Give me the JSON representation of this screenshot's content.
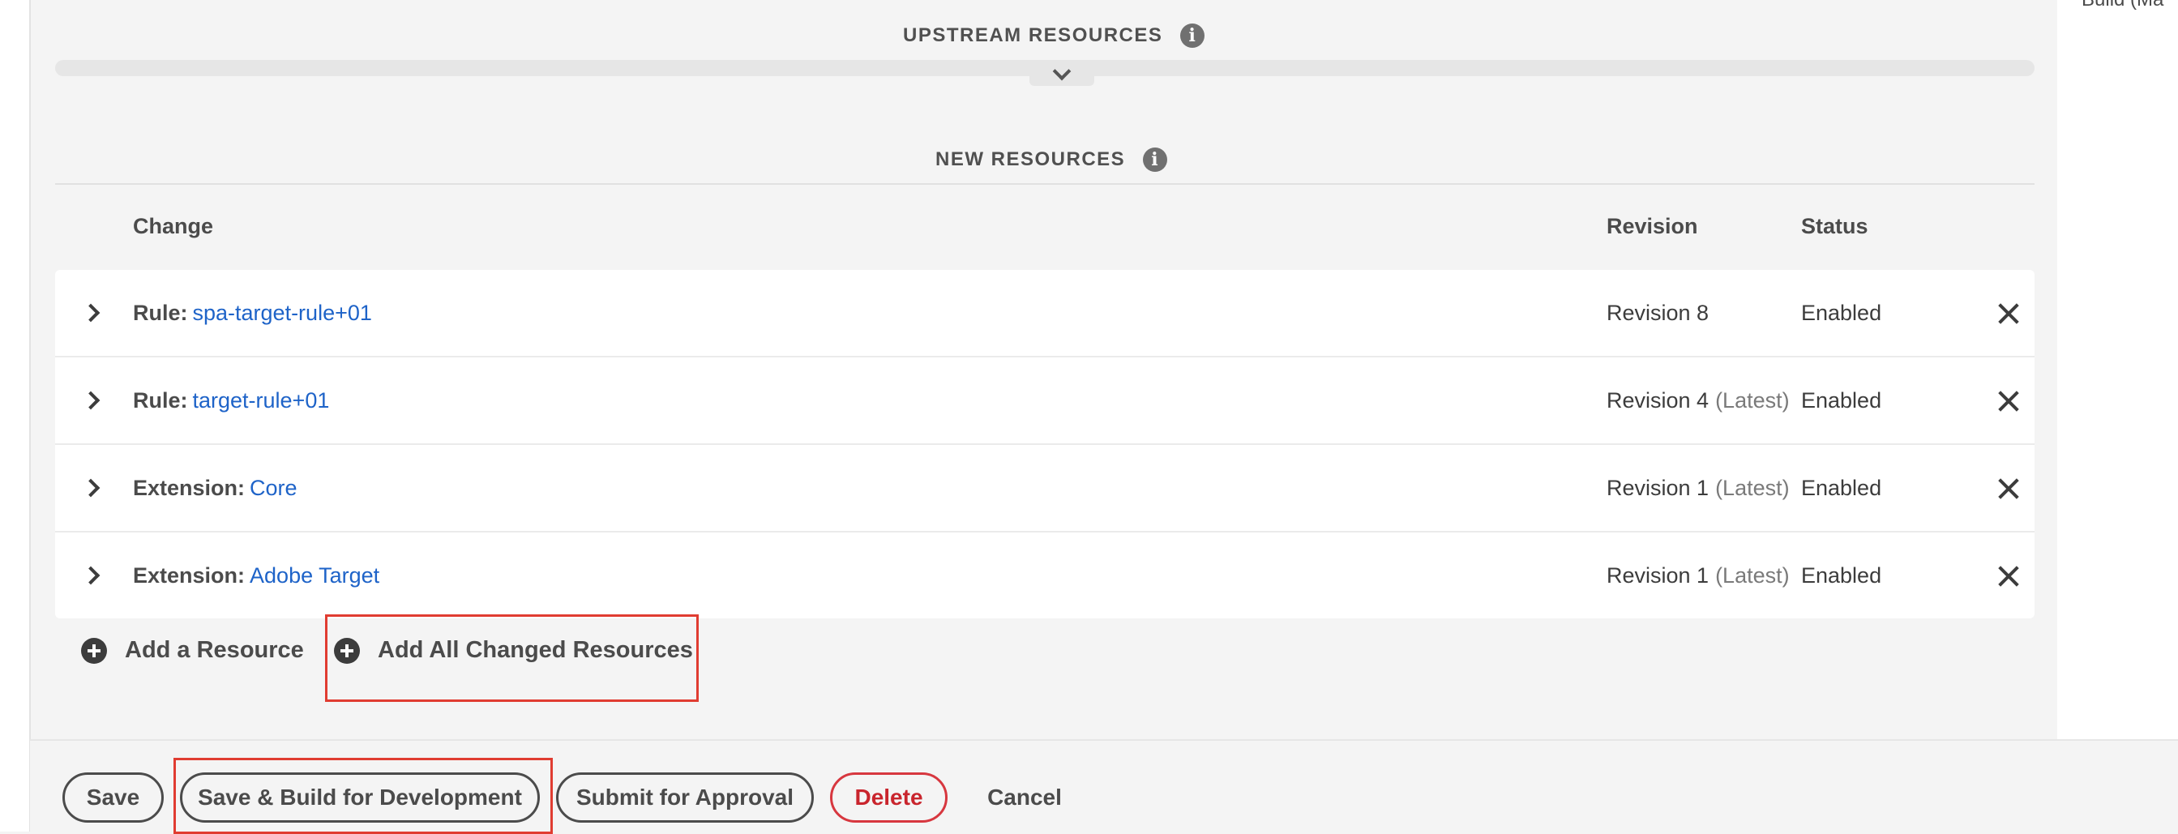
{
  "right_panel": {
    "partial_text": "Build (Ma"
  },
  "upstream": {
    "title": "UPSTREAM RESOURCES"
  },
  "new_resources": {
    "title": "NEW RESOURCES",
    "columns": {
      "change": "Change",
      "revision": "Revision",
      "status": "Status"
    },
    "rows": [
      {
        "type": "Rule:",
        "name": "spa-target-rule+01",
        "revision": "Revision 8",
        "latest": "",
        "status": "Enabled"
      },
      {
        "type": "Rule:",
        "name": "target-rule+01",
        "revision": "Revision 4",
        "latest": "(Latest)",
        "status": "Enabled"
      },
      {
        "type": "Extension:",
        "name": "Core",
        "revision": "Revision 1",
        "latest": "(Latest)",
        "status": "Enabled"
      },
      {
        "type": "Extension:",
        "name": "Adobe Target",
        "revision": "Revision 1",
        "latest": "(Latest)",
        "status": "Enabled"
      }
    ]
  },
  "actions": {
    "add_resource": "Add a Resource",
    "add_all_changed": "Add All Changed Resources"
  },
  "footer": {
    "save": "Save",
    "save_build": "Save & Build for Development",
    "submit": "Submit for Approval",
    "delete": "Delete",
    "cancel": "Cancel"
  },
  "colors": {
    "link": "#1e63c8",
    "highlight": "#e03c31",
    "danger": "#c9252d",
    "background": "#f4f4f4"
  },
  "icons": [
    "info-icon",
    "chevron-down-icon",
    "chevron-right-icon",
    "close-icon",
    "plus-circle-icon"
  ]
}
